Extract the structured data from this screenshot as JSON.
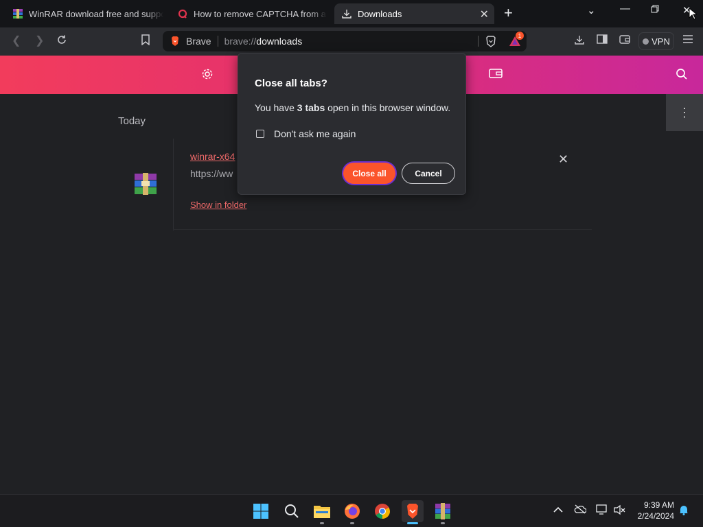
{
  "tabs": [
    {
      "title": "WinRAR download free and support:",
      "favicon": "winrar-icon"
    },
    {
      "title": "How to remove CAPTCHA from a site",
      "favicon": "quora-icon"
    },
    {
      "title": "Downloads",
      "favicon": "download-icon"
    }
  ],
  "toolbar": {
    "brand": "Brave",
    "url_scheme": "brave://",
    "url_host": "downloads",
    "rewards_badge": "1",
    "vpn_label": "VPN"
  },
  "downloads": {
    "section_label": "Today",
    "item": {
      "filename": "winrar-x64",
      "url": "https://ww",
      "show_in_folder": "Show in folder"
    }
  },
  "dialog": {
    "title": "Close all tabs?",
    "body_prefix": "You have ",
    "body_bold": "3 tabs",
    "body_suffix": " open in this browser window.",
    "checkbox_label": "Don't ask me again",
    "primary_label": "Close all",
    "secondary_label": "Cancel"
  },
  "taskbar": {
    "apps": [
      "start-icon",
      "search-icon",
      "file-explorer-icon",
      "firefox-icon",
      "chrome-icon",
      "brave-icon",
      "winrar-icon"
    ],
    "time": "9:39 AM",
    "date": "2/24/2024"
  },
  "colors": {
    "accent": "#fb542b",
    "banner_start": "#f23c5c",
    "banner_end": "#c8289b",
    "link": "#f06a6a"
  }
}
